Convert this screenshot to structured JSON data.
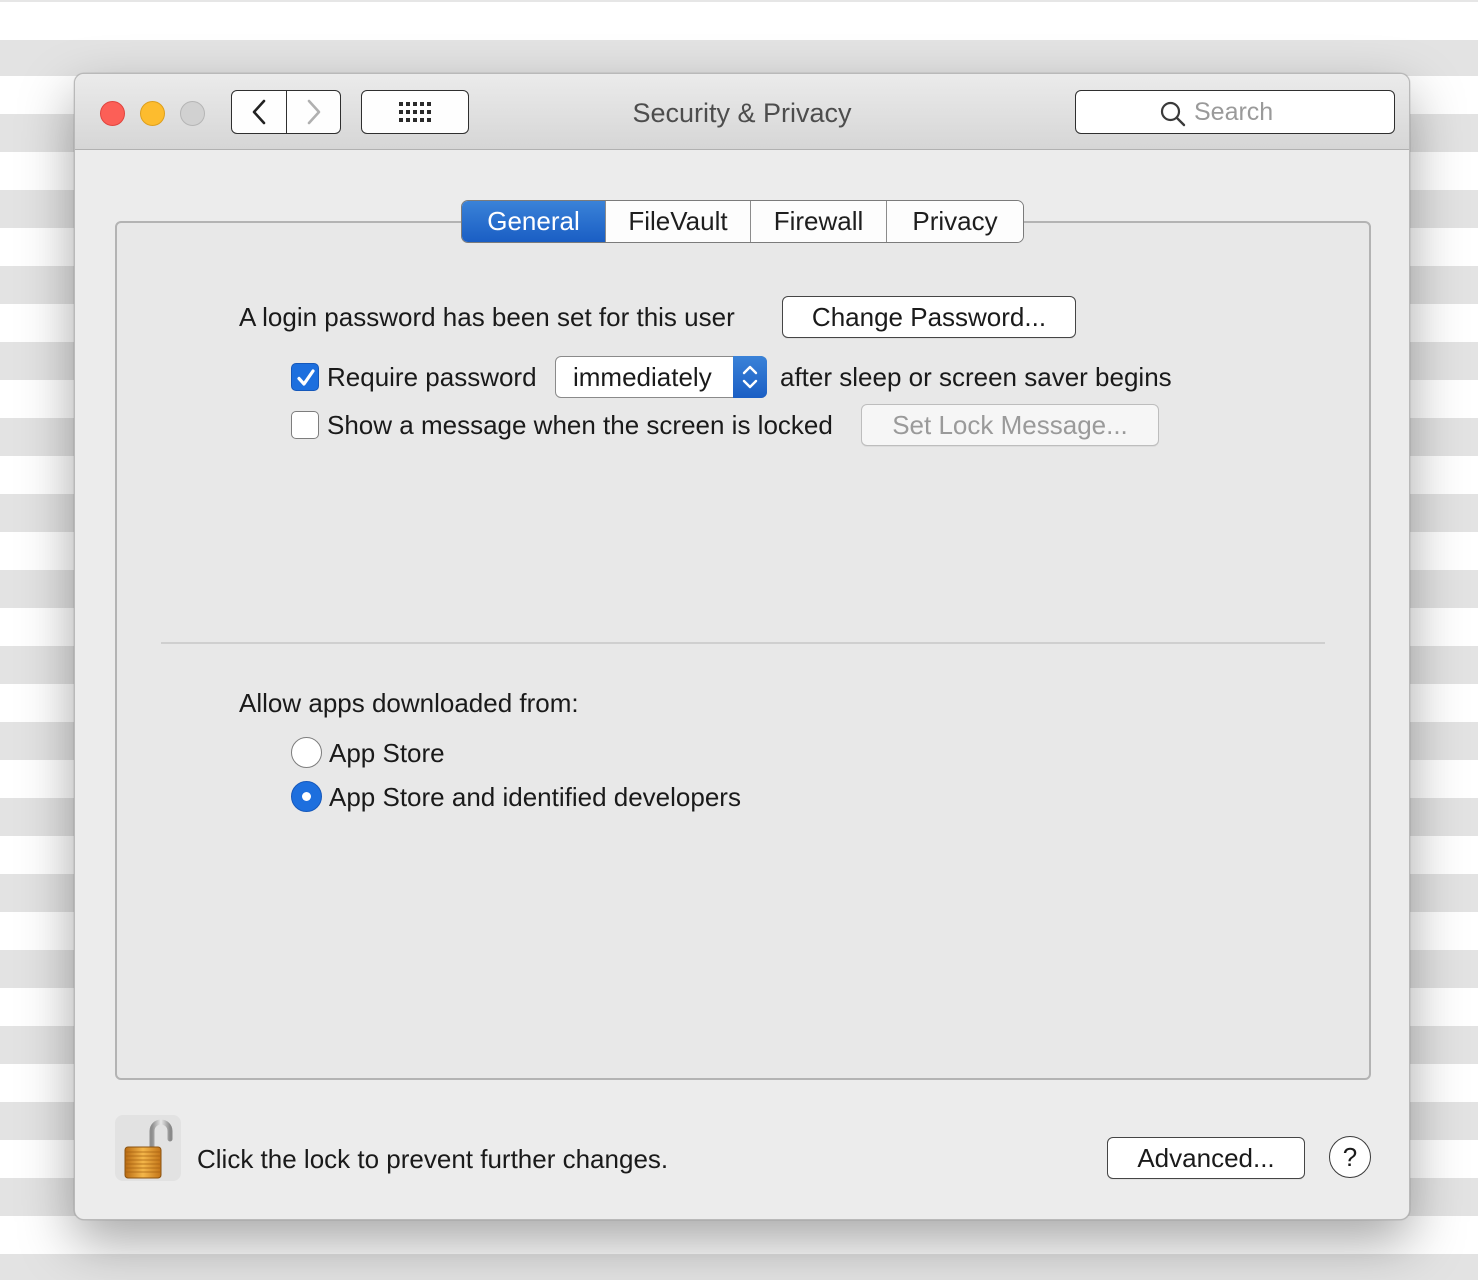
{
  "window": {
    "title": "Security & Privacy",
    "search_placeholder": "Search"
  },
  "tabs": [
    {
      "label": "General",
      "active": true
    },
    {
      "label": "FileVault",
      "active": false
    },
    {
      "label": "Firewall",
      "active": false
    },
    {
      "label": "Privacy",
      "active": false
    }
  ],
  "general": {
    "login_password_text": "A login password has been set for this user",
    "change_password_button": "Change Password...",
    "require_password": {
      "label": "Require password",
      "checked": true,
      "delay_value": "immediately",
      "suffix": "after sleep or screen saver begins"
    },
    "show_message": {
      "label": "Show a message when the screen is locked",
      "checked": false,
      "button": "Set Lock Message..."
    }
  },
  "allow_apps": {
    "heading": "Allow apps downloaded from:",
    "options": [
      {
        "label": "App Store",
        "selected": false
      },
      {
        "label": "App Store and identified developers",
        "selected": true
      }
    ]
  },
  "footer": {
    "lock_text": "Click the lock to prevent further changes.",
    "advanced_button": "Advanced...",
    "help_label": "?"
  },
  "colors": {
    "accent": "#1d6fde",
    "close": "#fc5f57",
    "minimize": "#fdbc2e",
    "zoom_disabled": "#d1d1d1"
  },
  "icons": [
    "back-chevron-icon",
    "forward-chevron-icon",
    "grid-icon",
    "search-icon",
    "checkmark-icon",
    "popup-arrows-icon",
    "unlocked-padlock-icon"
  ]
}
